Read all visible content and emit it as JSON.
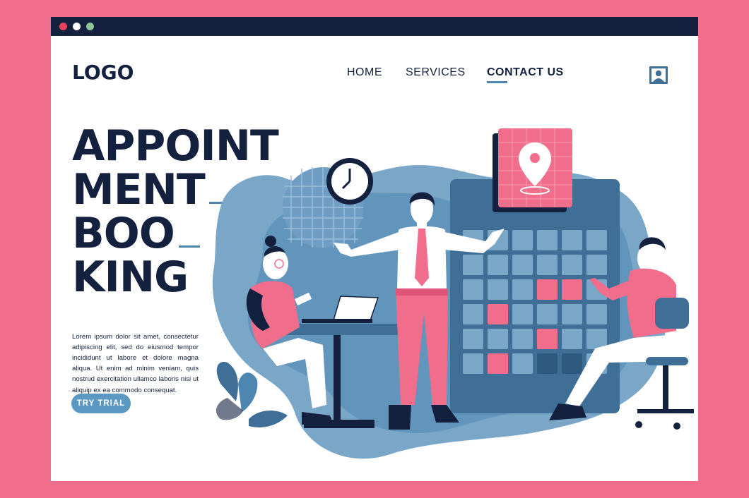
{
  "header": {
    "logo": "LOGO",
    "nav": {
      "home": "HOME",
      "services": "SERVICES",
      "contact": "CONTACT US"
    },
    "user_icon": "user-icon"
  },
  "hero": {
    "headline_lines": [
      "APPOINT",
      "MENT",
      "BOO",
      "KING"
    ],
    "body": "Lorem ipsum dolor sit amet, consectetur adipiscing elit, sed do eiusmod tempor incididunt ut labore et dolore magna aliqua. Ut enim ad minim veniam, quis nostrud exercitation ullamco laboris nisi ut aliquip ex ea commodo consequat.",
    "cta_label": "TRY TRIAL"
  },
  "illustration": {
    "icons": [
      "clock-icon",
      "map-pin-icon",
      "calendar-grid",
      "plant-icon"
    ]
  },
  "colors": {
    "frame": "#f06d8c",
    "navy": "#13213f",
    "blue": "#5b98c2",
    "pink": "#f06d8c",
    "accent": "#4d86b0"
  }
}
